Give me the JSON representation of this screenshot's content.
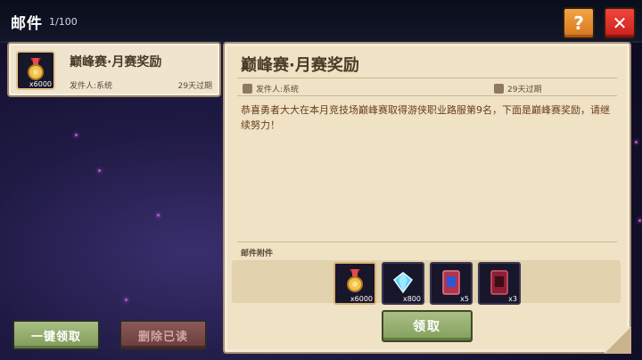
{
  "header": {
    "title": "邮件",
    "count": "1/100"
  },
  "mail_list": [
    {
      "title": "巅峰赛·月赛奖励",
      "sender": "发件人:系统",
      "expire": "29天过期",
      "thumb_qty": "x6000"
    }
  ],
  "detail": {
    "title": "巅峰赛·月赛奖励",
    "sender": "发件人:系统",
    "expire": "29天过期",
    "body": "恭喜勇者大大在本月竞技场巅峰赛取得游侠职业路服第9名，下面是巅峰赛奖励，请继续努力！",
    "attach_label": "邮件附件",
    "attachments": [
      {
        "icon": "medal-icon",
        "qty": "x6000"
      },
      {
        "icon": "diamond-icon",
        "qty": "x800"
      },
      {
        "icon": "blue-card-icon",
        "qty": "x5"
      },
      {
        "icon": "red-card-icon",
        "qty": "x3"
      }
    ],
    "claim_label": "领取"
  },
  "buttons": {
    "claim_all": "一键领取",
    "delete_read": "删除已读",
    "help": "?",
    "close": "✕"
  },
  "colors": {
    "accent_green": "#82a05d",
    "close_red": "#c81e1e",
    "help_orange": "#d6761c",
    "paper": "#efe2c5"
  }
}
